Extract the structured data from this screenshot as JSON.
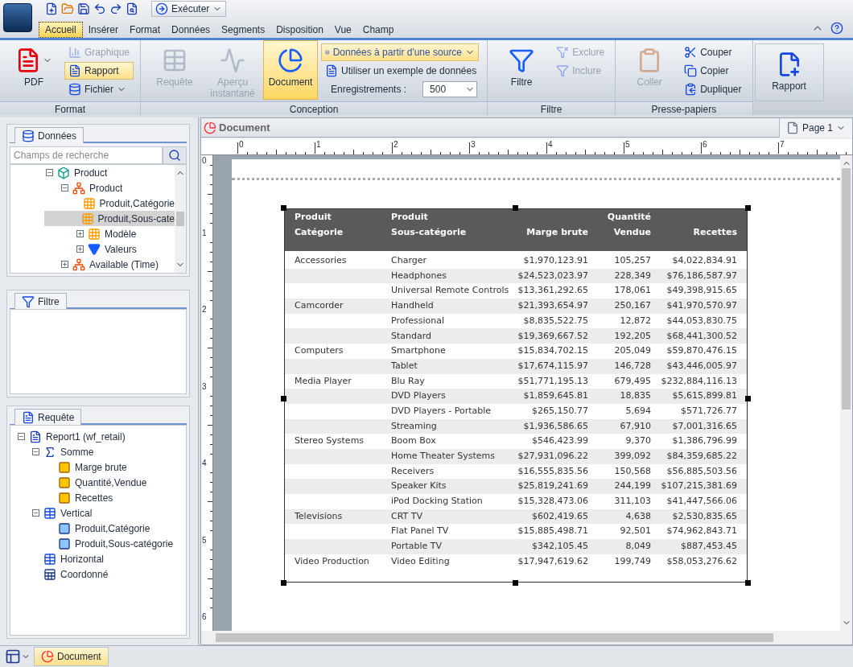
{
  "title_bar": {
    "run_button": "Exécuter"
  },
  "menu_tabs": [
    {
      "label": "Accueil",
      "selected": true
    },
    {
      "label": "Insérer",
      "selected": false
    },
    {
      "label": "Format",
      "selected": false
    },
    {
      "label": "Données",
      "selected": false
    },
    {
      "label": "Segments",
      "selected": false
    },
    {
      "label": "Disposition",
      "selected": false
    },
    {
      "label": "Vue",
      "selected": false
    },
    {
      "label": "Champ",
      "selected": false
    }
  ],
  "ribbon": {
    "groups": [
      {
        "label": "Format",
        "large": [
          {
            "label": "PDF",
            "disabled": false,
            "selected": false,
            "dropdown": true
          }
        ],
        "small": [
          {
            "kind": "button",
            "label": "Graphique",
            "disabled": true,
            "selected": false,
            "dropdown": false
          },
          {
            "kind": "button",
            "label": "Rapport",
            "disabled": false,
            "selected": true,
            "dropdown": false
          },
          {
            "kind": "button",
            "label": "Fichier",
            "disabled": false,
            "selected": false,
            "dropdown": true
          }
        ]
      },
      {
        "label": "Conception",
        "large": [
          {
            "label": "Requête",
            "disabled": true,
            "selected": false,
            "dropdown": false
          },
          {
            "label": "Aperçu instantané",
            "disabled": true,
            "selected": false,
            "dropdown": false
          },
          {
            "label": "Document",
            "disabled": false,
            "selected": true,
            "dropdown": false
          }
        ],
        "small": [
          {
            "kind": "combo",
            "label": "Données à partir d'une source",
            "disabled": false,
            "selected": true,
            "dropdown": true
          },
          {
            "kind": "button",
            "label": "Utiliser un exemple de données",
            "disabled": false,
            "selected": false,
            "dropdown": false
          },
          {
            "kind": "field",
            "label": "Enregistrements :",
            "value": "500",
            "dropdown": true
          }
        ]
      },
      {
        "label": "Filtre",
        "large": [
          {
            "label": "Filtre",
            "disabled": false,
            "selected": false,
            "dropdown": false
          }
        ],
        "small": [
          {
            "kind": "button",
            "label": "Exclure",
            "disabled": true,
            "selected": false,
            "dropdown": false
          },
          {
            "kind": "button",
            "label": "Inclure",
            "disabled": true,
            "selected": false,
            "dropdown": false
          }
        ]
      },
      {
        "label": "Presse-papiers",
        "large": [
          {
            "label": "Coller",
            "disabled": true,
            "selected": false,
            "dropdown": false
          }
        ],
        "small": [
          {
            "kind": "button",
            "label": "Couper",
            "disabled": false,
            "selected": false,
            "dropdown": false
          },
          {
            "kind": "button",
            "label": "Copier",
            "disabled": false,
            "selected": false,
            "dropdown": false
          },
          {
            "kind": "button",
            "label": "Dupliquer",
            "disabled": false,
            "selected": false,
            "dropdown": false
          }
        ]
      },
      {
        "large": [
          {
            "label": "Rapport",
            "disabled": false,
            "selected": false,
            "dropdown": false
          }
        ]
      }
    ]
  },
  "data_panel": {
    "title": "Données",
    "search_placeholder": "Champs de recherche",
    "tree": [
      {
        "label": "Product",
        "kind": "cube",
        "expanded": true,
        "selected": false,
        "children": [
          {
            "label": "Product",
            "kind": "hierarchy",
            "expanded": true,
            "selected": false,
            "children": [
              {
                "label": "Produit,Catégorie",
                "kind": "level",
                "selected": false
              },
              {
                "label": "Produit,Sous-cate",
                "kind": "level",
                "selected": true
              },
              {
                "label": "Modèle",
                "kind": "level",
                "expanded": false,
                "selected": false
              },
              {
                "label": "Valeurs",
                "kind": "measures",
                "expanded": false,
                "selected": false
              }
            ]
          },
          {
            "label": "Available (Time)",
            "kind": "hierarchy",
            "expanded": false,
            "selected": false
          }
        ]
      }
    ]
  },
  "filter_panel": {
    "title": "Filtre"
  },
  "query_panel": {
    "title": "Requête",
    "tree": [
      {
        "label": "Report1 (wf_retail)",
        "kind": "report",
        "expanded": true,
        "children": [
          {
            "label": "Somme",
            "kind": "sum",
            "expanded": true,
            "children": [
              {
                "label": "Marge brute",
                "kind": "measure"
              },
              {
                "label": "Quantité,Vendue",
                "kind": "measure"
              },
              {
                "label": "Recettes",
                "kind": "measure"
              }
            ]
          },
          {
            "label": "Vertical",
            "kind": "grid",
            "expanded": true,
            "children": [
              {
                "label": "Produit,Catégorie",
                "kind": "dimension"
              },
              {
                "label": "Produit,Sous-catégorie",
                "kind": "dimension"
              }
            ]
          },
          {
            "label": "Horizontal",
            "kind": "grid"
          },
          {
            "label": "Coordonné",
            "kind": "grid-coord"
          }
        ]
      }
    ]
  },
  "document": {
    "title": "Document",
    "page_button": "Page 1",
    "ruler": {
      "horizontal": [
        "0",
        "1",
        "2",
        "3",
        "4",
        "5",
        "6",
        "7"
      ],
      "vertical": [
        "0",
        "1",
        "2",
        "3",
        "4",
        "5",
        "6"
      ]
    },
    "table": {
      "columns": [
        {
          "top": "Produit",
          "label": "Catégorie"
        },
        {
          "top": "Produit",
          "label": "Sous-catégorie"
        },
        {
          "label": "Marge brute"
        },
        {
          "top": "Quantité",
          "label": "Vendue"
        },
        {
          "label": "Recettes"
        }
      ],
      "groups": [
        {
          "category": "Accessories",
          "rows": [
            [
              "Charger",
              "$1,970,123.91",
              "105,257",
              "$4,022,834.91"
            ],
            [
              "Headphones",
              "$24,523,023.97",
              "228,349",
              "$76,186,587.97"
            ],
            [
              "Universal Remote Controls",
              "$13,361,292.65",
              "178,061",
              "$49,398,915.65"
            ]
          ]
        },
        {
          "category": "Camcorder",
          "rows": [
            [
              "Handheld",
              "$21,393,654.97",
              "250,167",
              "$41,970,570.97"
            ],
            [
              "Professional",
              "$8,835,522.75",
              "12,872",
              "$44,053,830.75"
            ],
            [
              "Standard",
              "$19,369,667.52",
              "192,205",
              "$68,441,300.52"
            ]
          ]
        },
        {
          "category": "Computers",
          "rows": [
            [
              "Smartphone",
              "$15,834,702.15",
              "205,049",
              "$59,870,476.15"
            ],
            [
              "Tablet",
              "$17,674,115.97",
              "146,728",
              "$43,446,005.97"
            ]
          ]
        },
        {
          "category": "Media Player",
          "rows": [
            [
              "Blu Ray",
              "$51,771,195.13",
              "679,495",
              "$232,884,116.13"
            ],
            [
              "DVD Players",
              "$1,859,645.81",
              "18,835",
              "$5,615,899.81"
            ],
            [
              "DVD Players - Portable",
              "$265,150.77",
              "5,694",
              "$571,726.77"
            ],
            [
              "Streaming",
              "$1,936,586.65",
              "67,910",
              "$7,001,316.65"
            ]
          ]
        },
        {
          "category": "Stereo Systems",
          "rows": [
            [
              "Boom Box",
              "$546,423.99",
              "9,370",
              "$1,386,796.99"
            ],
            [
              "Home Theater Systems",
              "$27,931,096.22",
              "399,092",
              "$84,359,685.22"
            ],
            [
              "Receivers",
              "$16,555,835.56",
              "150,568",
              "$56,885,503.56"
            ],
            [
              "Speaker Kits",
              "$25,819,241.69",
              "244,199",
              "$107,215,381.69"
            ],
            [
              "iPod Docking Station",
              "$15,328,473.06",
              "311,103",
              "$41,447,566.06"
            ]
          ]
        },
        {
          "category": "Televisions",
          "rows": [
            [
              "CRT TV",
              "$602,419.65",
              "4,638",
              "$2,530,835.65"
            ],
            [
              "Flat Panel TV",
              "$15,885,498.71",
              "92,501",
              "$74,962,843.71"
            ],
            [
              "Portable TV",
              "$342,105.45",
              "8,049",
              "$887,453.45"
            ]
          ]
        },
        {
          "category": "Video Production",
          "rows": [
            [
              "Video Editing",
              "$17,947,619.62",
              "199,749",
              "$58,053,276.62"
            ]
          ]
        }
      ]
    }
  },
  "taskbar": {
    "tabs": [
      {
        "label": "Document",
        "selected": true
      }
    ]
  }
}
